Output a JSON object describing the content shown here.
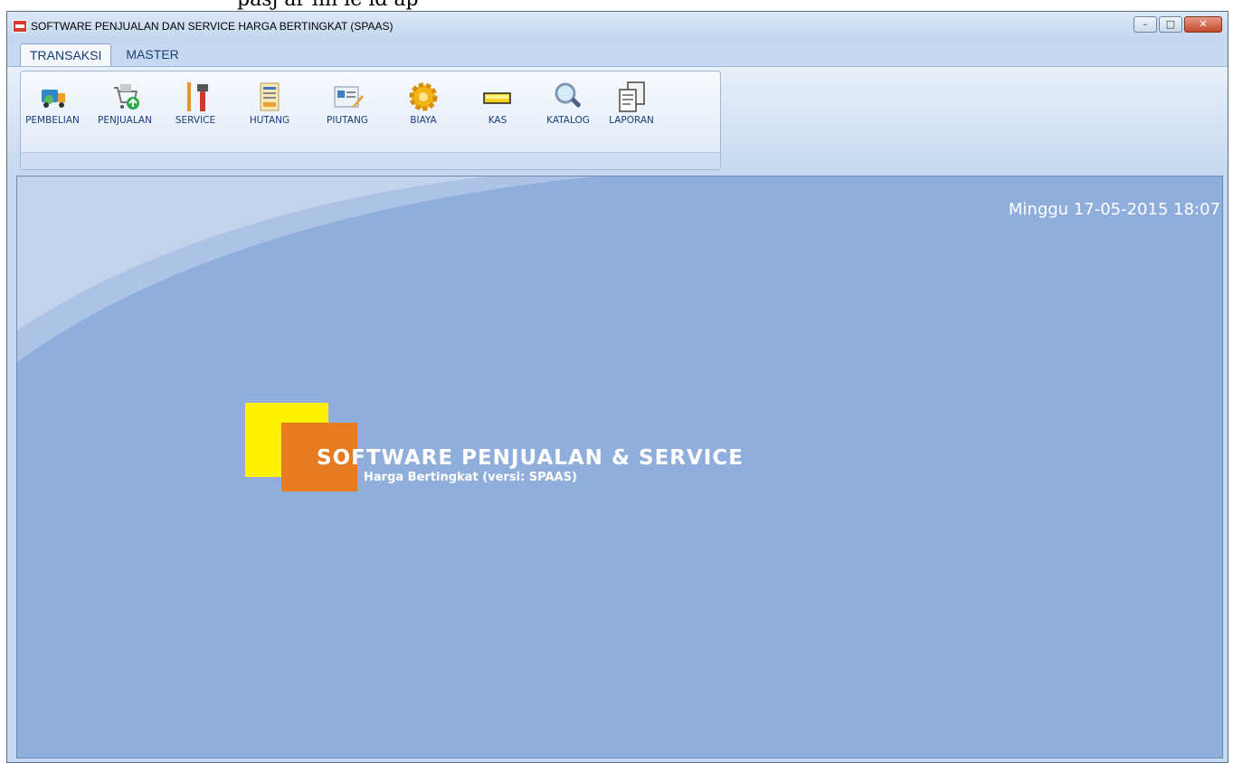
{
  "app": {
    "title": "SOFTWARE PENJUALAN DAN SERVICE HARGA BERTINGKAT (SPAAS)"
  },
  "header_fragment": "pasj  ar  lin  ie  id ap",
  "window_controls": {
    "minimize": "–",
    "maximize": "□",
    "close": "✕"
  },
  "tabs": [
    {
      "label": "TRANSAKSI",
      "active": true
    },
    {
      "label": "MASTER",
      "active": false
    }
  ],
  "ribbon": {
    "buttons": [
      {
        "label": "PEMBELIAN",
        "icon": "truck-icon"
      },
      {
        "label": "PENJUALAN",
        "icon": "cart-icon"
      },
      {
        "label": "SERVICE",
        "icon": "tools-icon"
      },
      {
        "label": "HUTANG",
        "icon": "ledger-icon"
      },
      {
        "label": "PIUTANG",
        "icon": "id-card-icon"
      },
      {
        "label": "BIAYA",
        "icon": "gear-icon"
      },
      {
        "label": "KAS",
        "icon": "gold-bar-icon"
      },
      {
        "label": "KATALOG",
        "icon": "magnifier-icon"
      },
      {
        "label": "LAPORAN",
        "icon": "documents-icon"
      }
    ]
  },
  "workspace": {
    "datetime": "Minggu  17-05-2015  18:07",
    "splash_title": "SOFTWARE PENJUALAN & SERVICE",
    "splash_subtitle": "Harga Bertingkat (versi: SPAAS)"
  },
  "colors": {
    "workspace_bg": "#8faedc",
    "accent_yellow": "#fff200",
    "accent_orange": "#e67b1f",
    "close_button": "#c44a2e"
  }
}
